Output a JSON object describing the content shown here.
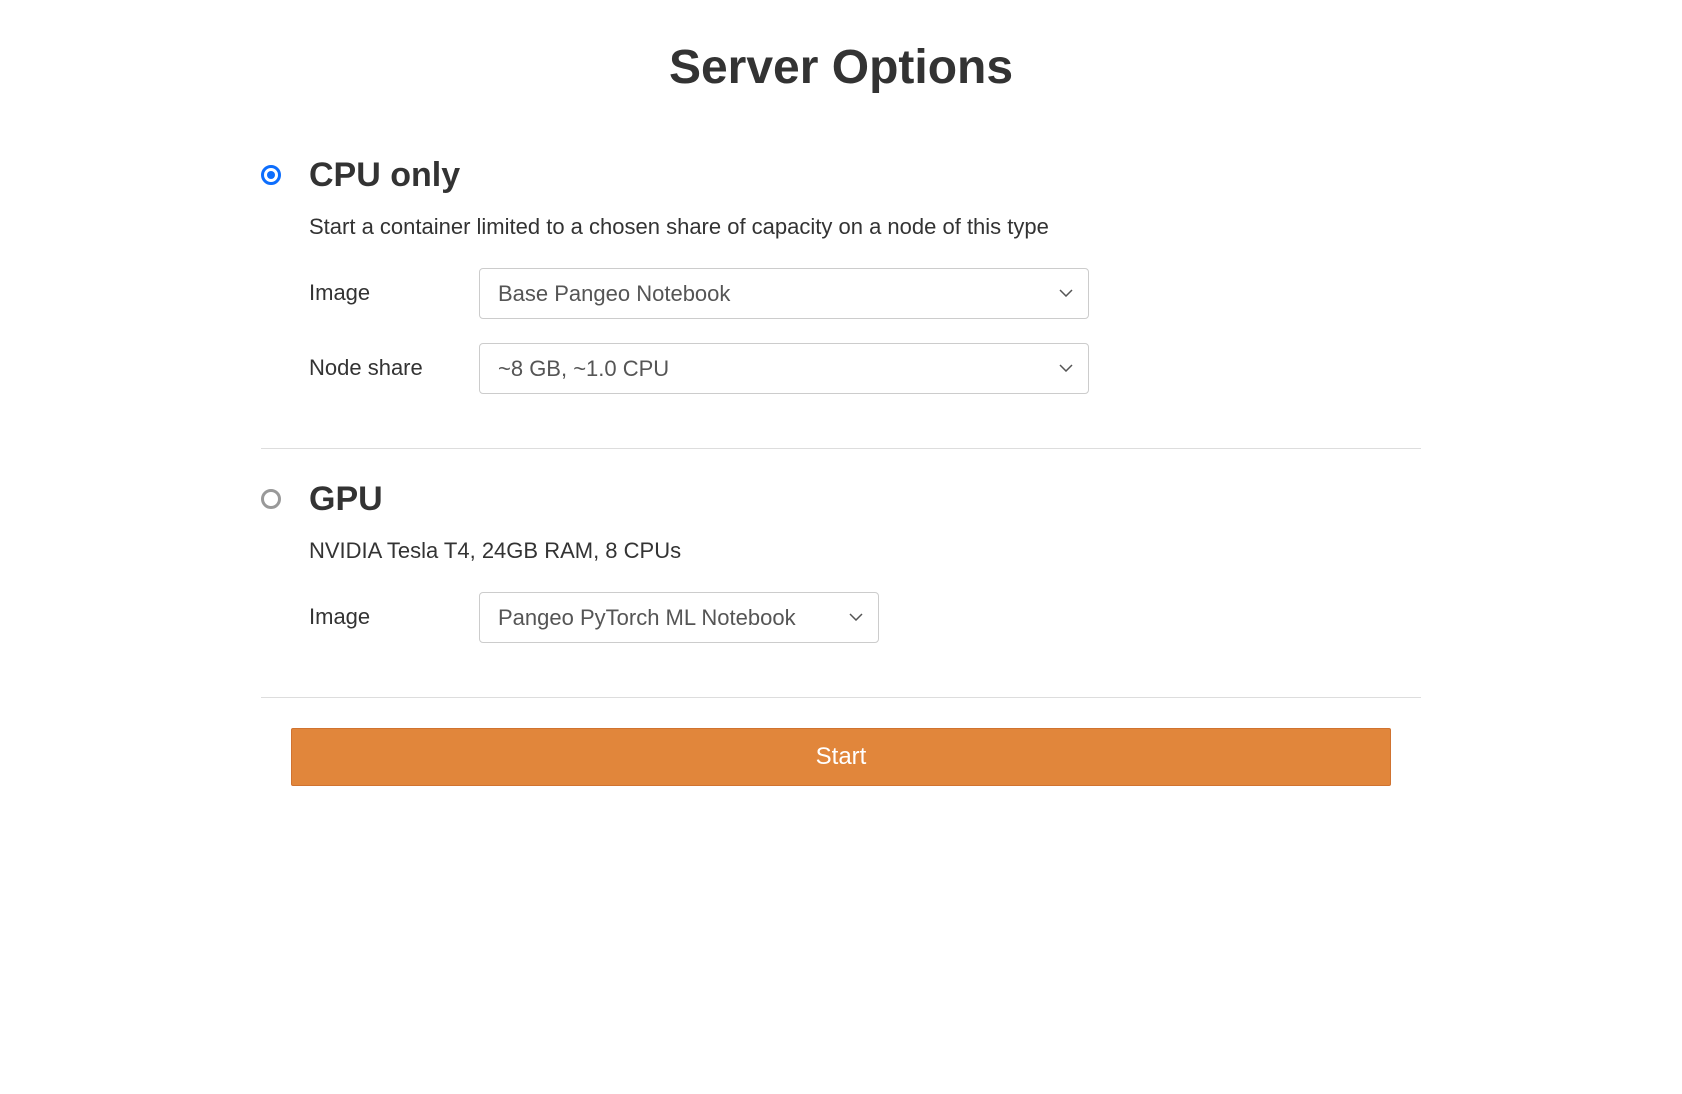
{
  "page_title": "Server Options",
  "profiles": [
    {
      "title": "CPU only",
      "description": "Start a container limited to a chosen share of capacity on a node of this type",
      "selected": true,
      "fields": [
        {
          "label": "Image",
          "value": "Base Pangeo Notebook"
        },
        {
          "label": "Node share",
          "value": "~8 GB, ~1.0 CPU"
        }
      ]
    },
    {
      "title": "GPU",
      "description": "NVIDIA Tesla T4, 24GB RAM, 8 CPUs",
      "selected": false,
      "fields": [
        {
          "label": "Image",
          "value": "Pangeo PyTorch ML Notebook"
        }
      ]
    }
  ],
  "start_button_label": "Start",
  "colors": {
    "accent": "#e1863b",
    "radio_selected": "#0d6efd"
  }
}
